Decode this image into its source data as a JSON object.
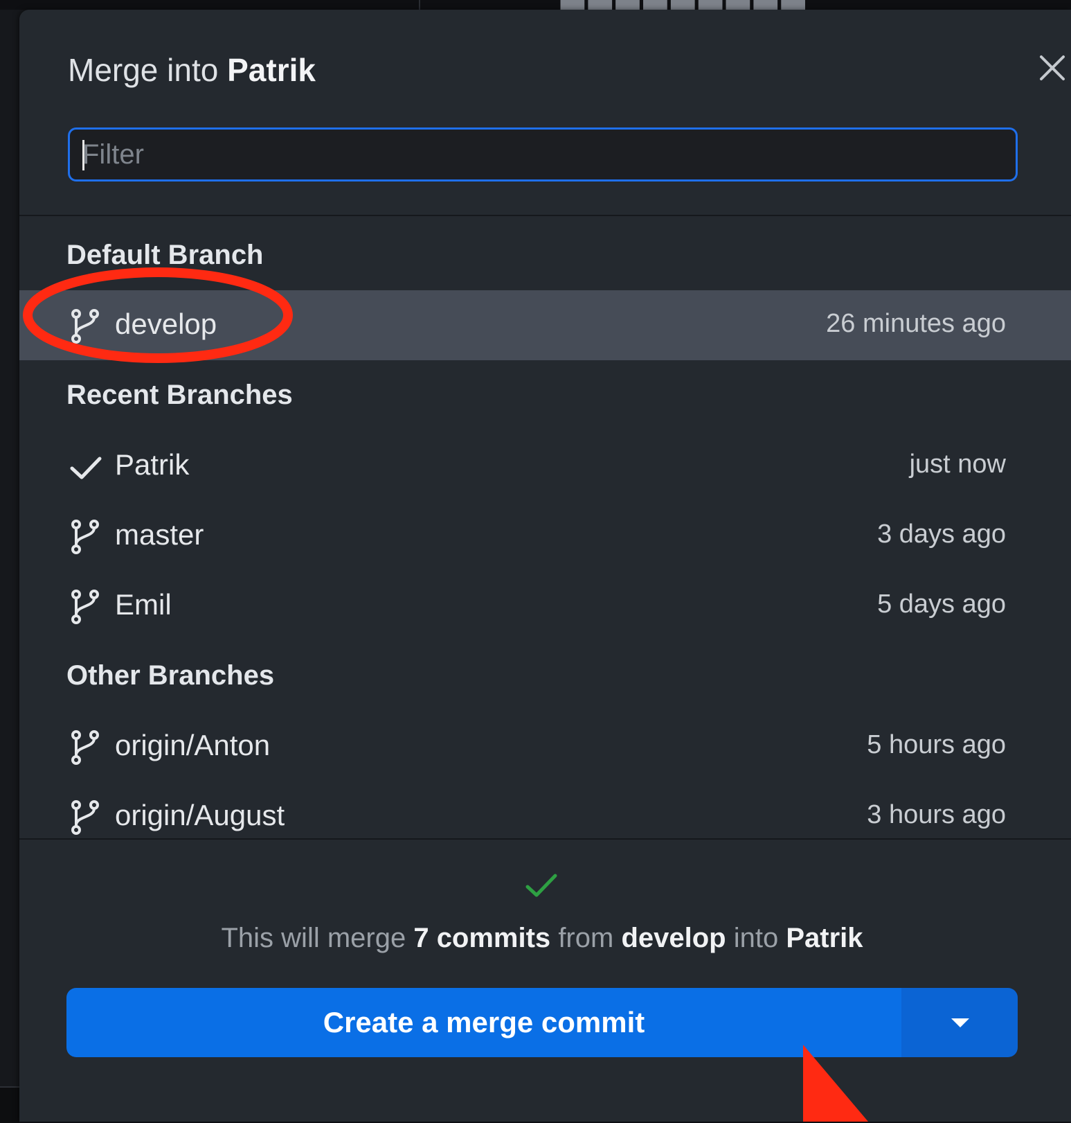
{
  "dialog": {
    "title_prefix": "Merge into",
    "title_branch": "Patrik",
    "filter": {
      "placeholder": "Filter",
      "value": ""
    },
    "close_icon": "close-icon"
  },
  "sections": {
    "default": {
      "label": "Default Branch",
      "items": [
        {
          "name": "develop",
          "time": "26 minutes ago",
          "icon": "git-branch-icon",
          "selected": true
        }
      ]
    },
    "recent": {
      "label": "Recent Branches",
      "items": [
        {
          "name": "Patrik",
          "time": "just now",
          "icon": "checkmark-icon"
        },
        {
          "name": "master",
          "time": "3 days ago",
          "icon": "git-branch-icon"
        },
        {
          "name": "Emil",
          "time": "5 days ago",
          "icon": "git-branch-icon"
        }
      ]
    },
    "other": {
      "label": "Other Branches",
      "items": [
        {
          "name": "origin/Anton",
          "time": "5 hours ago",
          "icon": "git-branch-icon"
        },
        {
          "name": "origin/August",
          "time": "3 hours ago",
          "icon": "git-branch-icon"
        }
      ]
    }
  },
  "footer": {
    "status_icon": "success-check-icon",
    "summary": {
      "part1": "This will merge",
      "commits": "7 commits",
      "part2": "from",
      "source": "develop",
      "part3": "into",
      "target": "Patrik"
    },
    "merge_button_label": "Create a merge commit",
    "dropdown_icon": "caret-down-icon"
  },
  "colors": {
    "dialog_bg": "#24292f",
    "selected_row_bg": "#464c57",
    "accent_blue": "#0a6fe6",
    "focus_border": "#1f6feb",
    "success_green": "#2ea043",
    "annotation_red": "#ff2a12"
  },
  "annotations": [
    "red-ellipse-highlight",
    "red-arrow-pointer"
  ]
}
